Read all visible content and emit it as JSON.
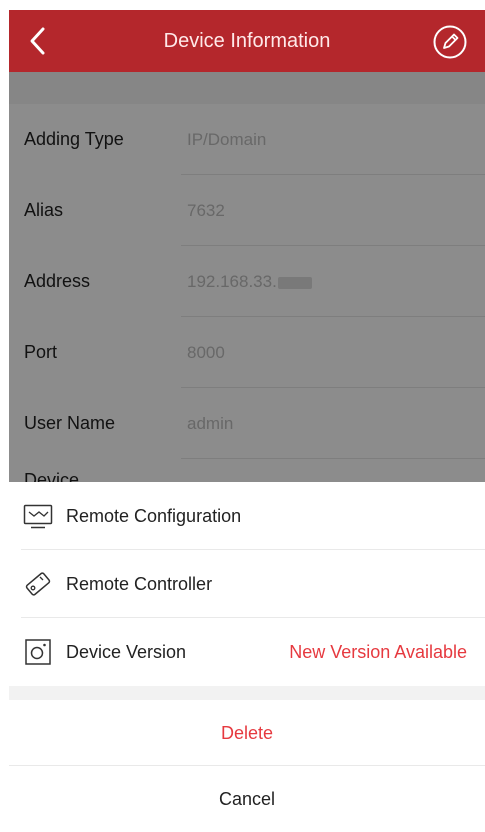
{
  "header": {
    "title": "Device Information",
    "back_icon": "chevron-left-icon",
    "edit_icon": "pencil-circle-icon"
  },
  "fields": [
    {
      "label": "Adding Type",
      "value": "IP/Domain"
    },
    {
      "label": "Alias",
      "value": "7632"
    },
    {
      "label": "Address",
      "value": "192.168.33."
    },
    {
      "label": "Port",
      "value": "8000"
    },
    {
      "label": "User Name",
      "value": "admin"
    },
    {
      "label": "Device",
      "value": ""
    }
  ],
  "menu": {
    "remote_configuration": "Remote Configuration",
    "remote_controller": "Remote Controller",
    "device_version": "Device Version",
    "new_version_badge": "New Version Available",
    "delete": "Delete",
    "cancel": "Cancel"
  },
  "colors": {
    "accent": "#b4272c",
    "alert": "#e6393f"
  }
}
